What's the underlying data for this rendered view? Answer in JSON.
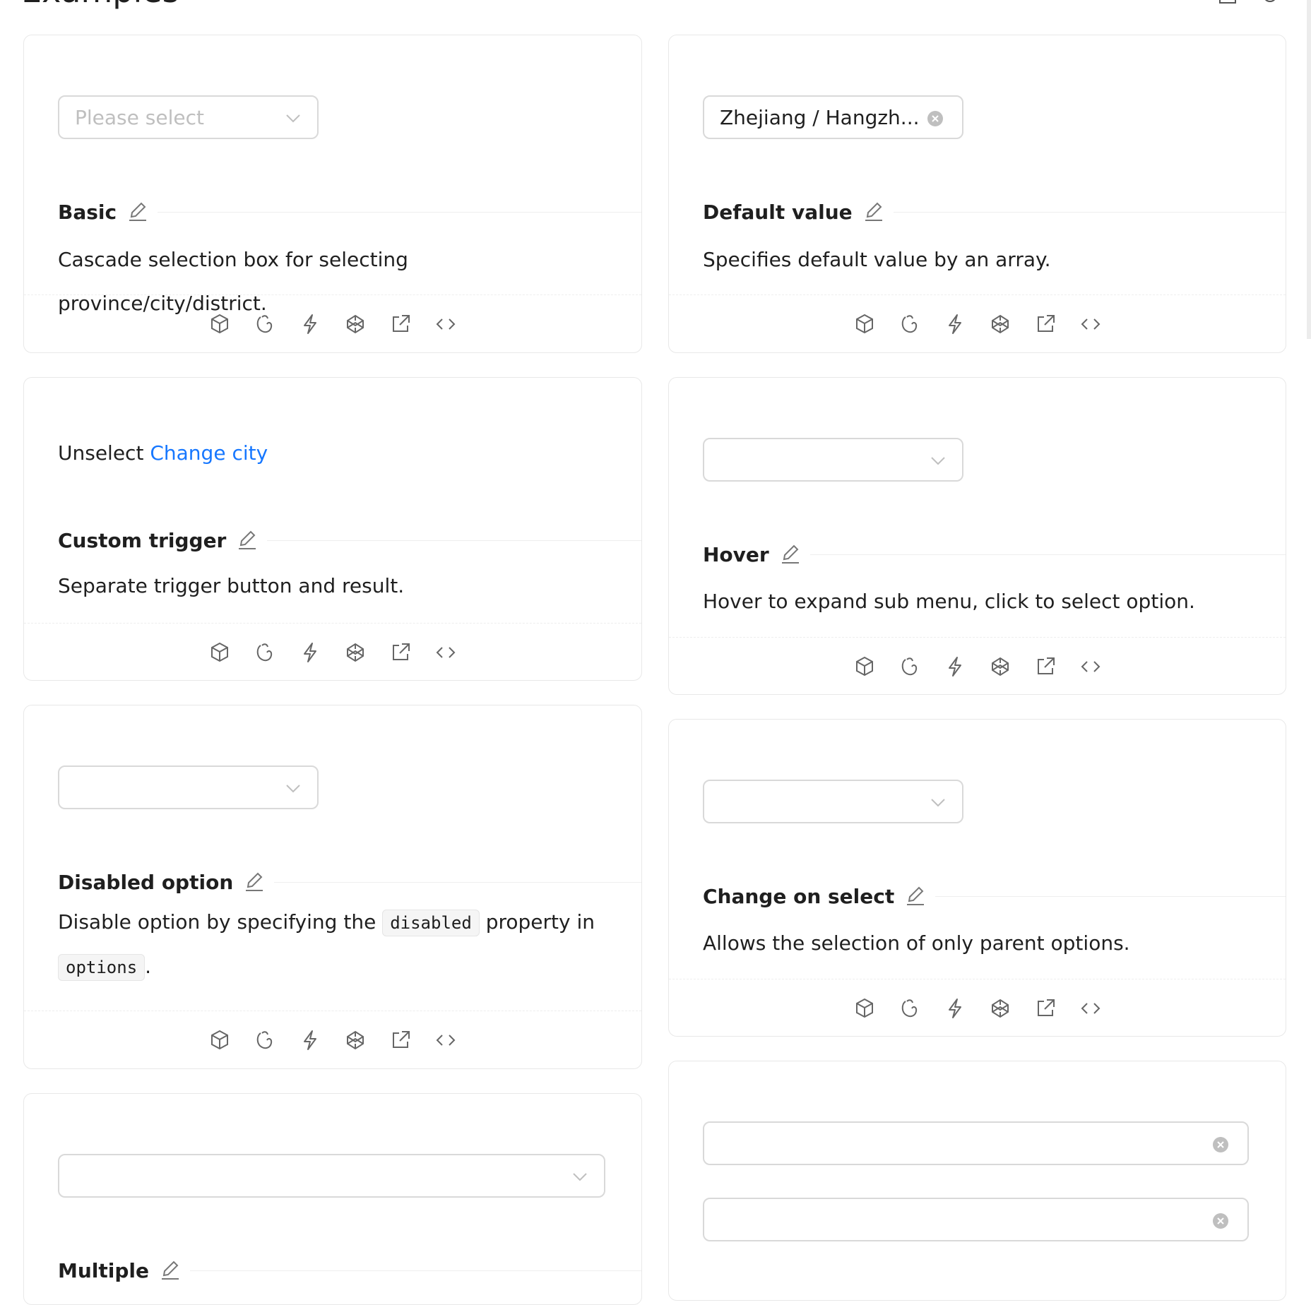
{
  "page": {
    "heading": "Examples"
  },
  "demos": {
    "basic": {
      "select_placeholder": "Please select",
      "title": "Basic",
      "description": "Cascade selection box for selecting province/city/district."
    },
    "default_value": {
      "select_value": "Zhejiang / Hangzh...",
      "title": "Default value",
      "description": "Specifies default value by an array."
    },
    "custom_trigger": {
      "prefix": "Unselect",
      "link": "Change city",
      "title": "Custom trigger",
      "description": "Separate trigger button and result."
    },
    "hover": {
      "title": "Hover",
      "description": "Hover to expand sub menu, click to select option."
    },
    "disabled_option": {
      "title": "Disabled option",
      "desc_part1": "Disable option by specifying the",
      "code1": "disabled",
      "desc_part2": "property in",
      "code2": "options",
      "desc_end": "."
    },
    "change_on_select": {
      "title": "Change on select",
      "description": "Allows the selection of only parent options."
    },
    "multiple": {
      "title": "Multiple"
    }
  },
  "action_icons": [
    "codesandbox-icon",
    "codepen-icon",
    "stackblitz-icon",
    "codepen-logo-icon",
    "open-external-icon",
    "code-icon"
  ],
  "colors": {
    "link": "#1677ff",
    "border": "#d9d9d9",
    "placeholder": "#bfbfbf"
  }
}
